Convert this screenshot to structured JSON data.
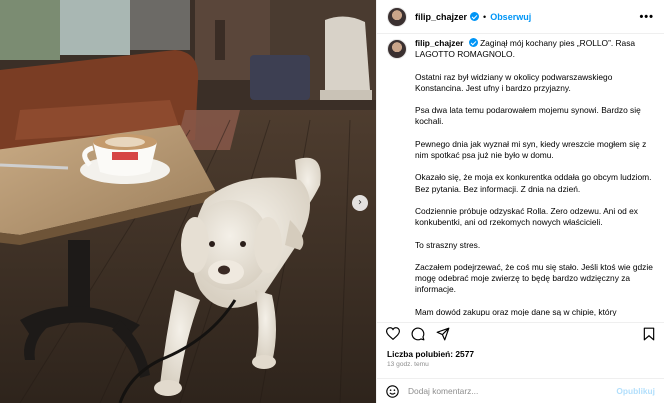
{
  "post": {
    "username": "filip_chajzer",
    "separator": "•",
    "follow_label": "Obserwuj",
    "more_label": "•••",
    "icons": {
      "verified": "verified-badge-icon",
      "more": "more-options-icon",
      "next": "next-arrow-icon",
      "like": "heart-icon",
      "comment": "comment-icon",
      "share": "share-icon",
      "save": "bookmark-icon",
      "emoji": "emoji-icon"
    },
    "next_arrow": "›"
  },
  "caption": {
    "username": "filip_chajzer",
    "paragraphs": [
      "Zaginął mój kochany pies „ROLLO”. Rasa LAGOTTO ROMAGNOLO.",
      "Ostatni raz był widziany w okolicy podwarszawskiego Konstancina. Jest ufny i bardzo przyjazny.",
      "Psa dwa lata temu podarowałem mojemu synowi. Bardzo się kochali.",
      "Pewnego dnia jak wyznał mi syn, kiedy wreszcie mogłem się z nim spotkać psa już nie było w domu.",
      "Okazało się, że moja ex konkurentka oddała go obcym ludziom. Bez pytania. Bez informacji. Z dnia na dzień.",
      "Codziennie próbuje odzyskać Rolla. Zero odzewu. Ani od ex konkubentki, ani od rzekomych nowych właścicieli.",
      "To straszny stres.",
      "Zaczałem podejrzewać, że coś mu się stało. Jeśli ktoś wie gdzie mogę odebrać moje zwierzę to będę bardzo wdzięczny za informacje.",
      "Mam dowód zakupu oraz moje dane są w chipie, który kupowałem psu w pierwszym roku jego życia."
    ]
  },
  "stats": {
    "likes_label": "Liczba polubień: 2577",
    "time_label": "13 godz. temu"
  },
  "comment": {
    "placeholder": "Dodaj komentarz...",
    "publish_label": "Opublikuj"
  },
  "colors": {
    "accent": "#0095f6",
    "publish_disabled": "#b2dffc",
    "muted": "#8e8e8e",
    "divider": "#efefef"
  }
}
